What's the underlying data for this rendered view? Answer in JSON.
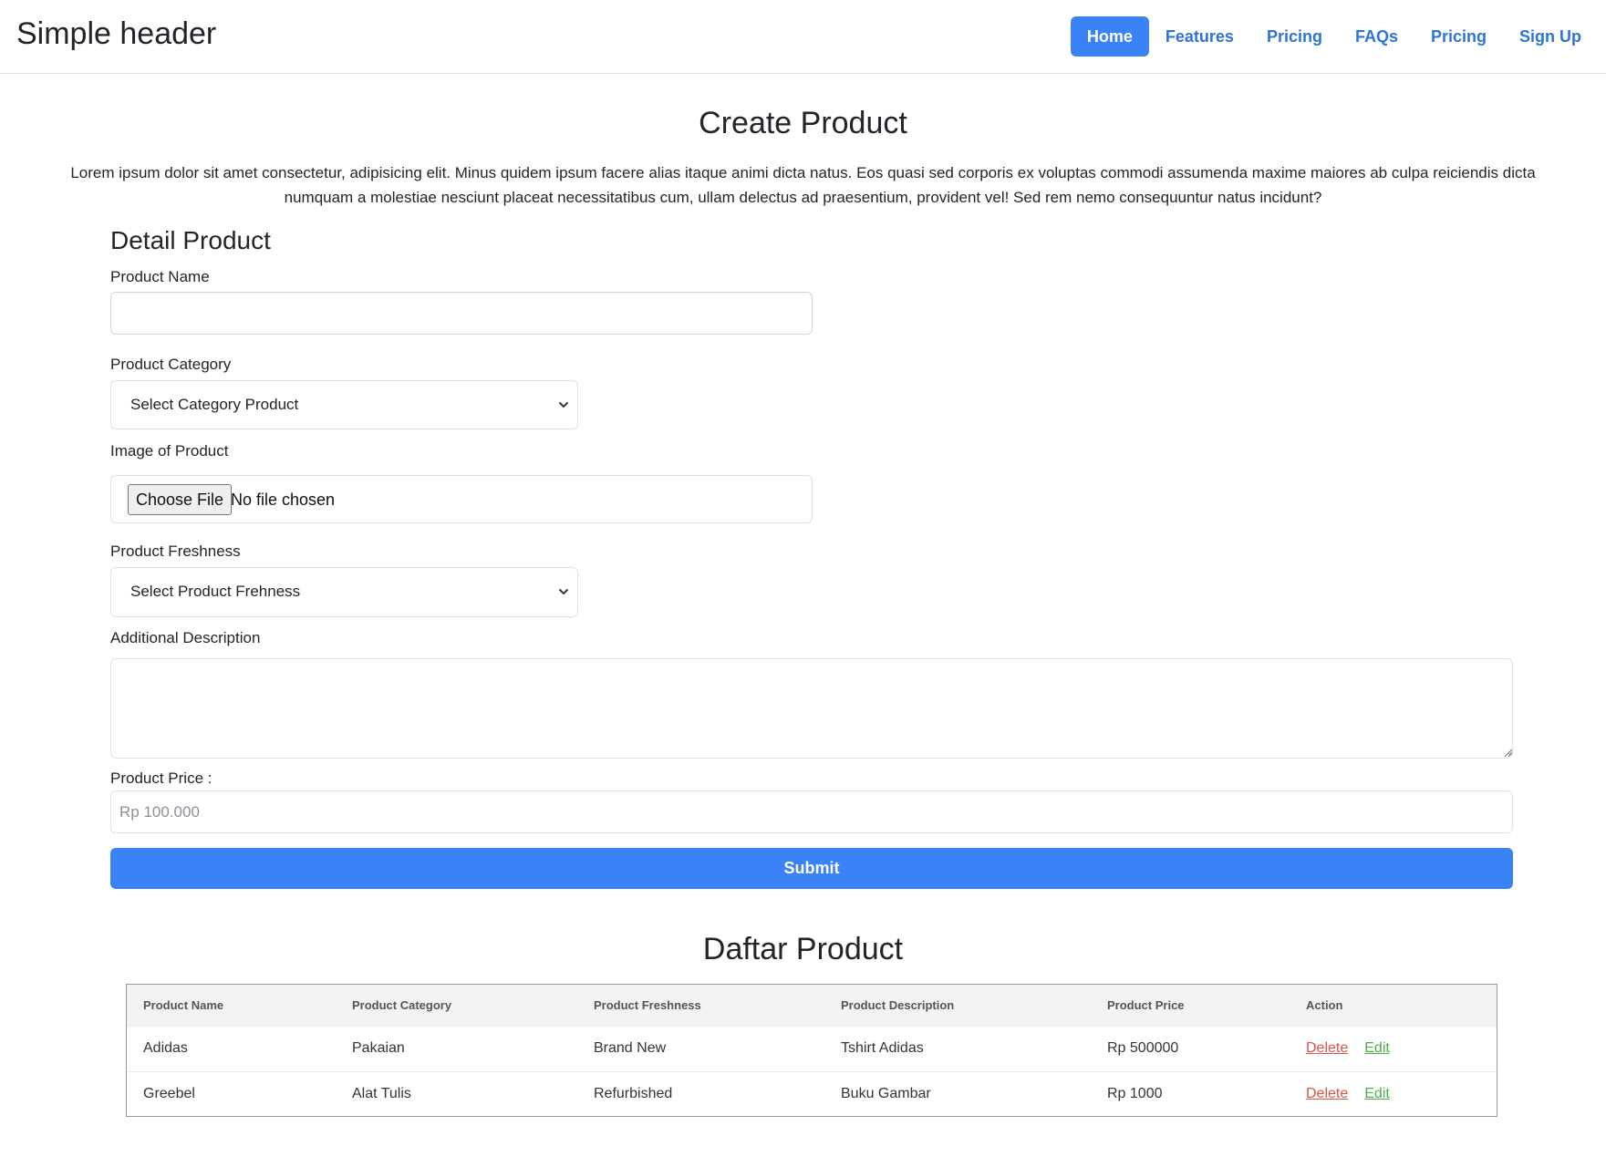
{
  "header": {
    "brand": "Simple header",
    "nav": [
      {
        "label": "Home",
        "active": true
      },
      {
        "label": "Features"
      },
      {
        "label": "Pricing"
      },
      {
        "label": "FAQs"
      },
      {
        "label": "Pricing"
      },
      {
        "label": "Sign Up"
      }
    ]
  },
  "page": {
    "title": "Create Product",
    "intro": "Lorem ipsum dolor sit amet consectetur, adipisicing elit. Minus quidem ipsum facere alias itaque animi dicta natus. Eos quasi sed corporis ex voluptas commodi assumenda maxime maiores ab culpa reiciendis dicta numquam a molestiae nesciunt placeat necessitatibus cum, ullam delectus ad praesentium, provident vel! Sed rem nemo consequuntur natus incidunt?"
  },
  "form": {
    "heading": "Detail Product",
    "product_name": {
      "label": "Product Name",
      "value": ""
    },
    "category": {
      "label": "Product Category",
      "selected": "Select Category Product"
    },
    "image": {
      "label": "Image of Product",
      "button": "Choose File",
      "status": "No file chosen"
    },
    "freshness": {
      "label": "Product Freshness",
      "selected": "Select Product Frehness"
    },
    "description": {
      "label": "Additional Description",
      "value": ""
    },
    "price": {
      "label": "Product Price :",
      "placeholder": "Rp 100.000"
    },
    "submit": "Submit"
  },
  "table": {
    "title": "Daftar Product",
    "columns": [
      "Product Name",
      "Product Category",
      "Product Freshness",
      "Product Description",
      "Product Price",
      "Action"
    ],
    "rows": [
      {
        "name": "Adidas",
        "category": "Pakaian",
        "freshness": "Brand New",
        "description": "Tshirt Adidas",
        "price": "Rp 500000"
      },
      {
        "name": "Greebel",
        "category": "Alat Tulis",
        "freshness": "Refurbished",
        "description": "Buku Gambar",
        "price": "Rp 1000"
      }
    ],
    "actions": {
      "delete": "Delete",
      "edit": "Edit"
    }
  },
  "colors": {
    "primary": "#3b82f6",
    "link": "#2f73d6",
    "delete": "#d9534f",
    "edit": "#4cae4c"
  },
  "icons": {
    "select_arrow": "chevron-down-icon",
    "textarea_resize": "resize-handle-icon"
  }
}
